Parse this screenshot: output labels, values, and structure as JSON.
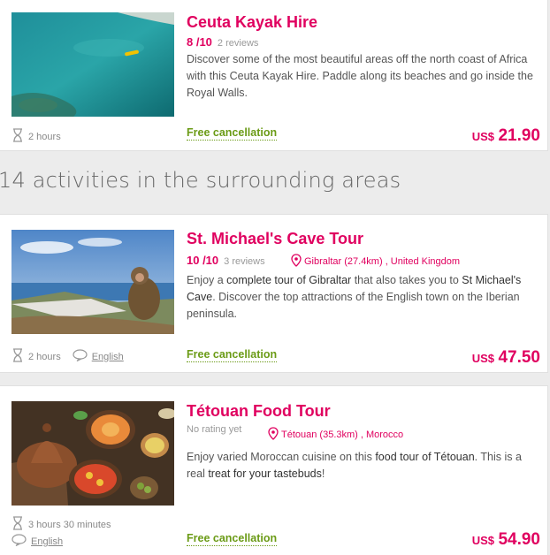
{
  "activities": [
    {
      "title": "Ceuta Kayak Hire",
      "score": "8 /10",
      "reviews": "2 reviews",
      "desc_parts": [
        "Discover some of the most beautiful areas off the north coast of Africa with this Ceuta Kayak Hire. Paddle along its beaches and go inside the Royal Walls."
      ],
      "duration": "2 hours",
      "free_cancellation": "Free cancellation",
      "currency": "US$",
      "price": "21.90"
    },
    {
      "title": "St. Michael's Cave Tour",
      "score": "10 /10",
      "reviews": "3 reviews",
      "location": "Gibraltar (27.4km) , United Kingdom",
      "desc_parts": [
        "Enjoy a ",
        "complete tour of Gibraltar",
        " that also takes you to ",
        "St Michael's Cave",
        ". Discover the top attractions of the English town on the Iberian peninsula."
      ],
      "duration": "2 hours",
      "language": "English",
      "free_cancellation": "Free cancellation",
      "currency": "US$",
      "price": "47.50"
    },
    {
      "title": "Tétouan Food Tour",
      "no_rating": "No rating yet",
      "location": "Tétouan (35.3km) , Morocco",
      "desc_parts": [
        "Enjoy varied Moroccan cuisine on this ",
        "food tour of Tétouan",
        ". This is a real ",
        "treat for your tastebuds",
        "!"
      ],
      "duration": "3 hours 30 minutes",
      "language": "English",
      "free_cancellation": "Free cancellation",
      "currency": "US$",
      "price": "54.90"
    }
  ],
  "section_title": "14 activities in the surrounding areas",
  "colors": {
    "accent": "#e0005f",
    "green": "#6b9b16"
  },
  "icons": [
    "hourglass-icon",
    "speech-bubble-icon",
    "location-pin-icon"
  ]
}
